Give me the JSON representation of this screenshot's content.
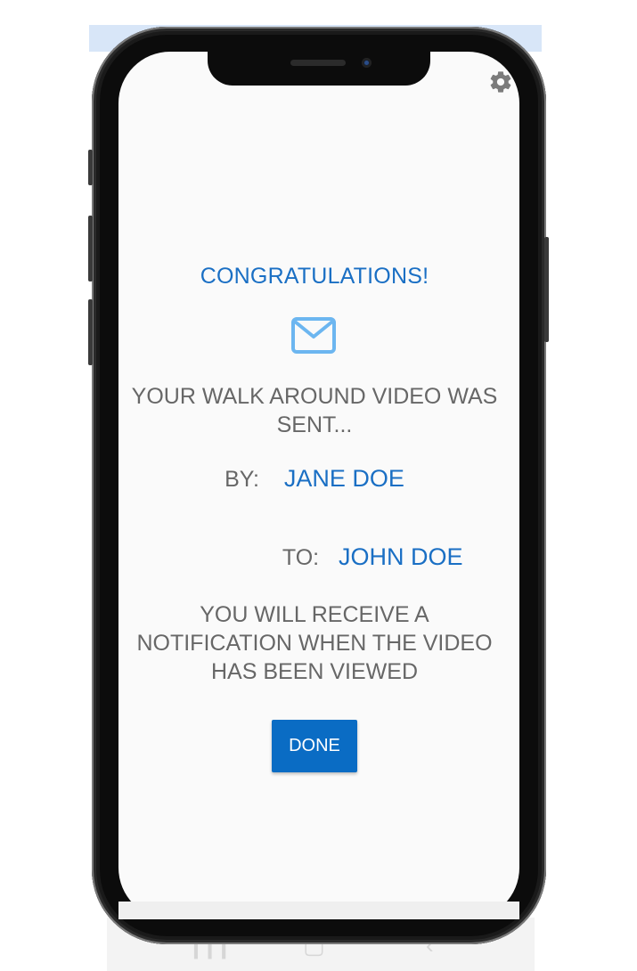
{
  "colors": {
    "accent": "#1a6fc4",
    "button": "#0a6cc4",
    "body_text": "#676767",
    "screen_bg": "#fafafa",
    "mail_icon": "#6cb6f0"
  },
  "header": {
    "settings_icon": "gear-icon"
  },
  "main": {
    "title": "CONGRATULATIONS!",
    "icon": "mail-icon",
    "message_line1": "YOUR WALK AROUND VIDEO WAS",
    "message_line2": "SENT...",
    "by_label": "BY:",
    "by_name": "JANE DOE",
    "to_label": "TO:",
    "to_name": "JOHN DOE",
    "notify_line1": "YOU WILL RECEIVE A",
    "notify_line2": "NOTIFICATION WHEN THE VIDEO",
    "notify_line3": "HAS BEEN VIEWED",
    "done_label": "DONE"
  }
}
